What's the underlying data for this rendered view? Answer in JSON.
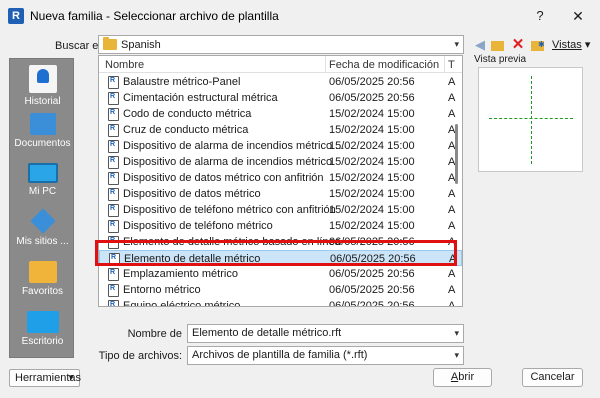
{
  "window": {
    "app_icon": "R",
    "title": "Nueva familia - Seleccionar archivo de plantilla",
    "help_glyph": "?",
    "close_glyph": "✕"
  },
  "lookin": {
    "label": "Buscar en:",
    "value": "Spanish"
  },
  "toolbar": {
    "back_glyph": "◀",
    "delete_glyph": "✕",
    "views_label": "Vistas",
    "views_chevron": "▾"
  },
  "places": [
    {
      "label": "Historial",
      "icon": "history-icon"
    },
    {
      "label": "Documentos",
      "icon": "documents-icon"
    },
    {
      "label": "Mi PC",
      "icon": "computer-icon"
    },
    {
      "label": "Mis sitios ...",
      "icon": "sites-icon"
    },
    {
      "label": "Favoritos",
      "icon": "favorites-icon"
    },
    {
      "label": "Escritorio",
      "icon": "desktop-icon"
    }
  ],
  "filelist": {
    "columns": [
      "Nombre",
      "Fecha de modificación",
      "T"
    ],
    "rows": [
      {
        "name": "Balaustre métrico-Panel",
        "date": "06/05/2025 20:56",
        "type": "A"
      },
      {
        "name": "Cimentación estructural métrica",
        "date": "06/05/2025 20:56",
        "type": "A"
      },
      {
        "name": "Codo de conducto métrica",
        "date": "15/02/2024 15:00",
        "type": "A"
      },
      {
        "name": "Cruz de conducto métrica",
        "date": "15/02/2024 15:00",
        "type": "A"
      },
      {
        "name": "Dispositivo de alarma de incendios métrico ...",
        "date": "15/02/2024 15:00",
        "type": "A"
      },
      {
        "name": "Dispositivo de alarma de incendios métrico",
        "date": "15/02/2024 15:00",
        "type": "A"
      },
      {
        "name": "Dispositivo de datos métrico con anfitrión",
        "date": "15/02/2024 15:00",
        "type": "A"
      },
      {
        "name": "Dispositivo de datos métrico",
        "date": "15/02/2024 15:00",
        "type": "A"
      },
      {
        "name": "Dispositivo de teléfono métrico con anfitrión",
        "date": "15/02/2024 15:00",
        "type": "A"
      },
      {
        "name": "Dispositivo de teléfono métrico",
        "date": "15/02/2024 15:00",
        "type": "A"
      },
      {
        "name": "Elemento de detalle métrico basado en línea",
        "date": "06/05/2025 20:56",
        "type": "A"
      },
      {
        "name": "Elemento de detalle métrico",
        "date": "06/05/2025 20:56",
        "type": "A"
      },
      {
        "name": "Emplazamiento métrico",
        "date": "06/05/2025 20:56",
        "type": "A"
      },
      {
        "name": "Entorno métrico",
        "date": "06/05/2025 20:56",
        "type": "A"
      },
      {
        "name": "Equipo eléctrico métrico",
        "date": "06/05/2025 20:56",
        "type": "A"
      }
    ],
    "selected_index": 11
  },
  "preview": {
    "label": "Vista previa"
  },
  "filename": {
    "label": "Nombre de",
    "value": "Elemento de detalle métrico.rft"
  },
  "filetype": {
    "label": "Tipo de archivos:",
    "value": "Archivos de plantilla de familia (*.rft)"
  },
  "buttons": {
    "tools": "Herramientas",
    "open_u": "A",
    "open_rest": "brir",
    "cancel": "Cancelar"
  },
  "colors": {
    "selection": "#cce4f7",
    "highlight": "#e01010",
    "preview_lines": "#1e9a1e"
  }
}
